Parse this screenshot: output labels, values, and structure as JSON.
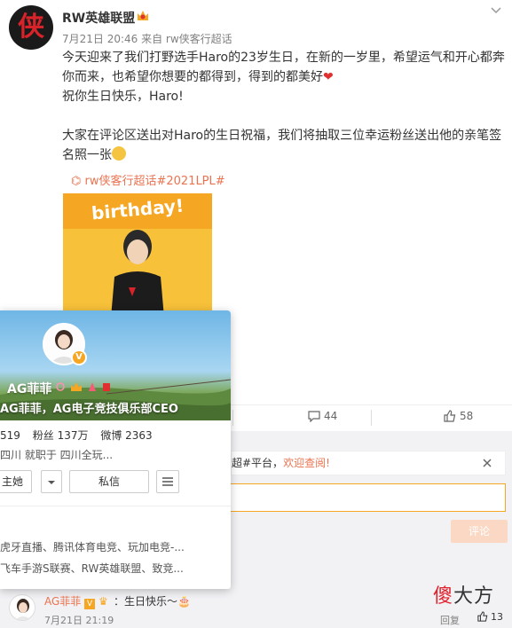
{
  "post": {
    "author": "RW英雄联盟",
    "logo_text": "侠",
    "meta": "7月21日 20:46 来自 rw侠客行超话",
    "line1": "今天迎来了我们打野选手Haro的23岁生日，在新的一岁里，希望运气和开心都奔",
    "line2": "你而来，也希望你想要的都得到，得到的都美好",
    "line3": "祝你生日快乐，Haro!",
    "line4": "大家在评论区送出对Haro的生日祝福，我们将抽取三位幸运粉丝送出他的亲笔签",
    "line5": "名照一张",
    "topic": "rw侠客行超话#2021LPL#",
    "image_text": "birthday!",
    "image_tag": "haro"
  },
  "popup": {
    "name": "AG菲菲",
    "bio": "AG菲菲，AG电子竞技俱乐部CEO",
    "following": "519",
    "followers_label": "粉丝",
    "followers": "137万",
    "posts_label": "微博",
    "posts": "2363",
    "location": "四川   就职于 四川全玩...",
    "follow_btn": "主她",
    "message_btn": "私信",
    "tags1": "虎牙直播、腾讯体育电竞、玩加电竞-...",
    "tags2": "飞车手游S联赛、RW英雄联盟、致竞..."
  },
  "actions": {
    "comments": "44",
    "likes": "58"
  },
  "comment_area": {
    "notice_prefix": "超#平台，",
    "notice_link": "欢迎查阅!",
    "submit": "评论"
  },
  "comment": {
    "name": "AG菲菲",
    "text": "：生日快乐～",
    "time": "7月21日 21:19",
    "reply": "回复",
    "likes": "13"
  },
  "watermark": {
    "red": "傻",
    "rest": "大方"
  }
}
